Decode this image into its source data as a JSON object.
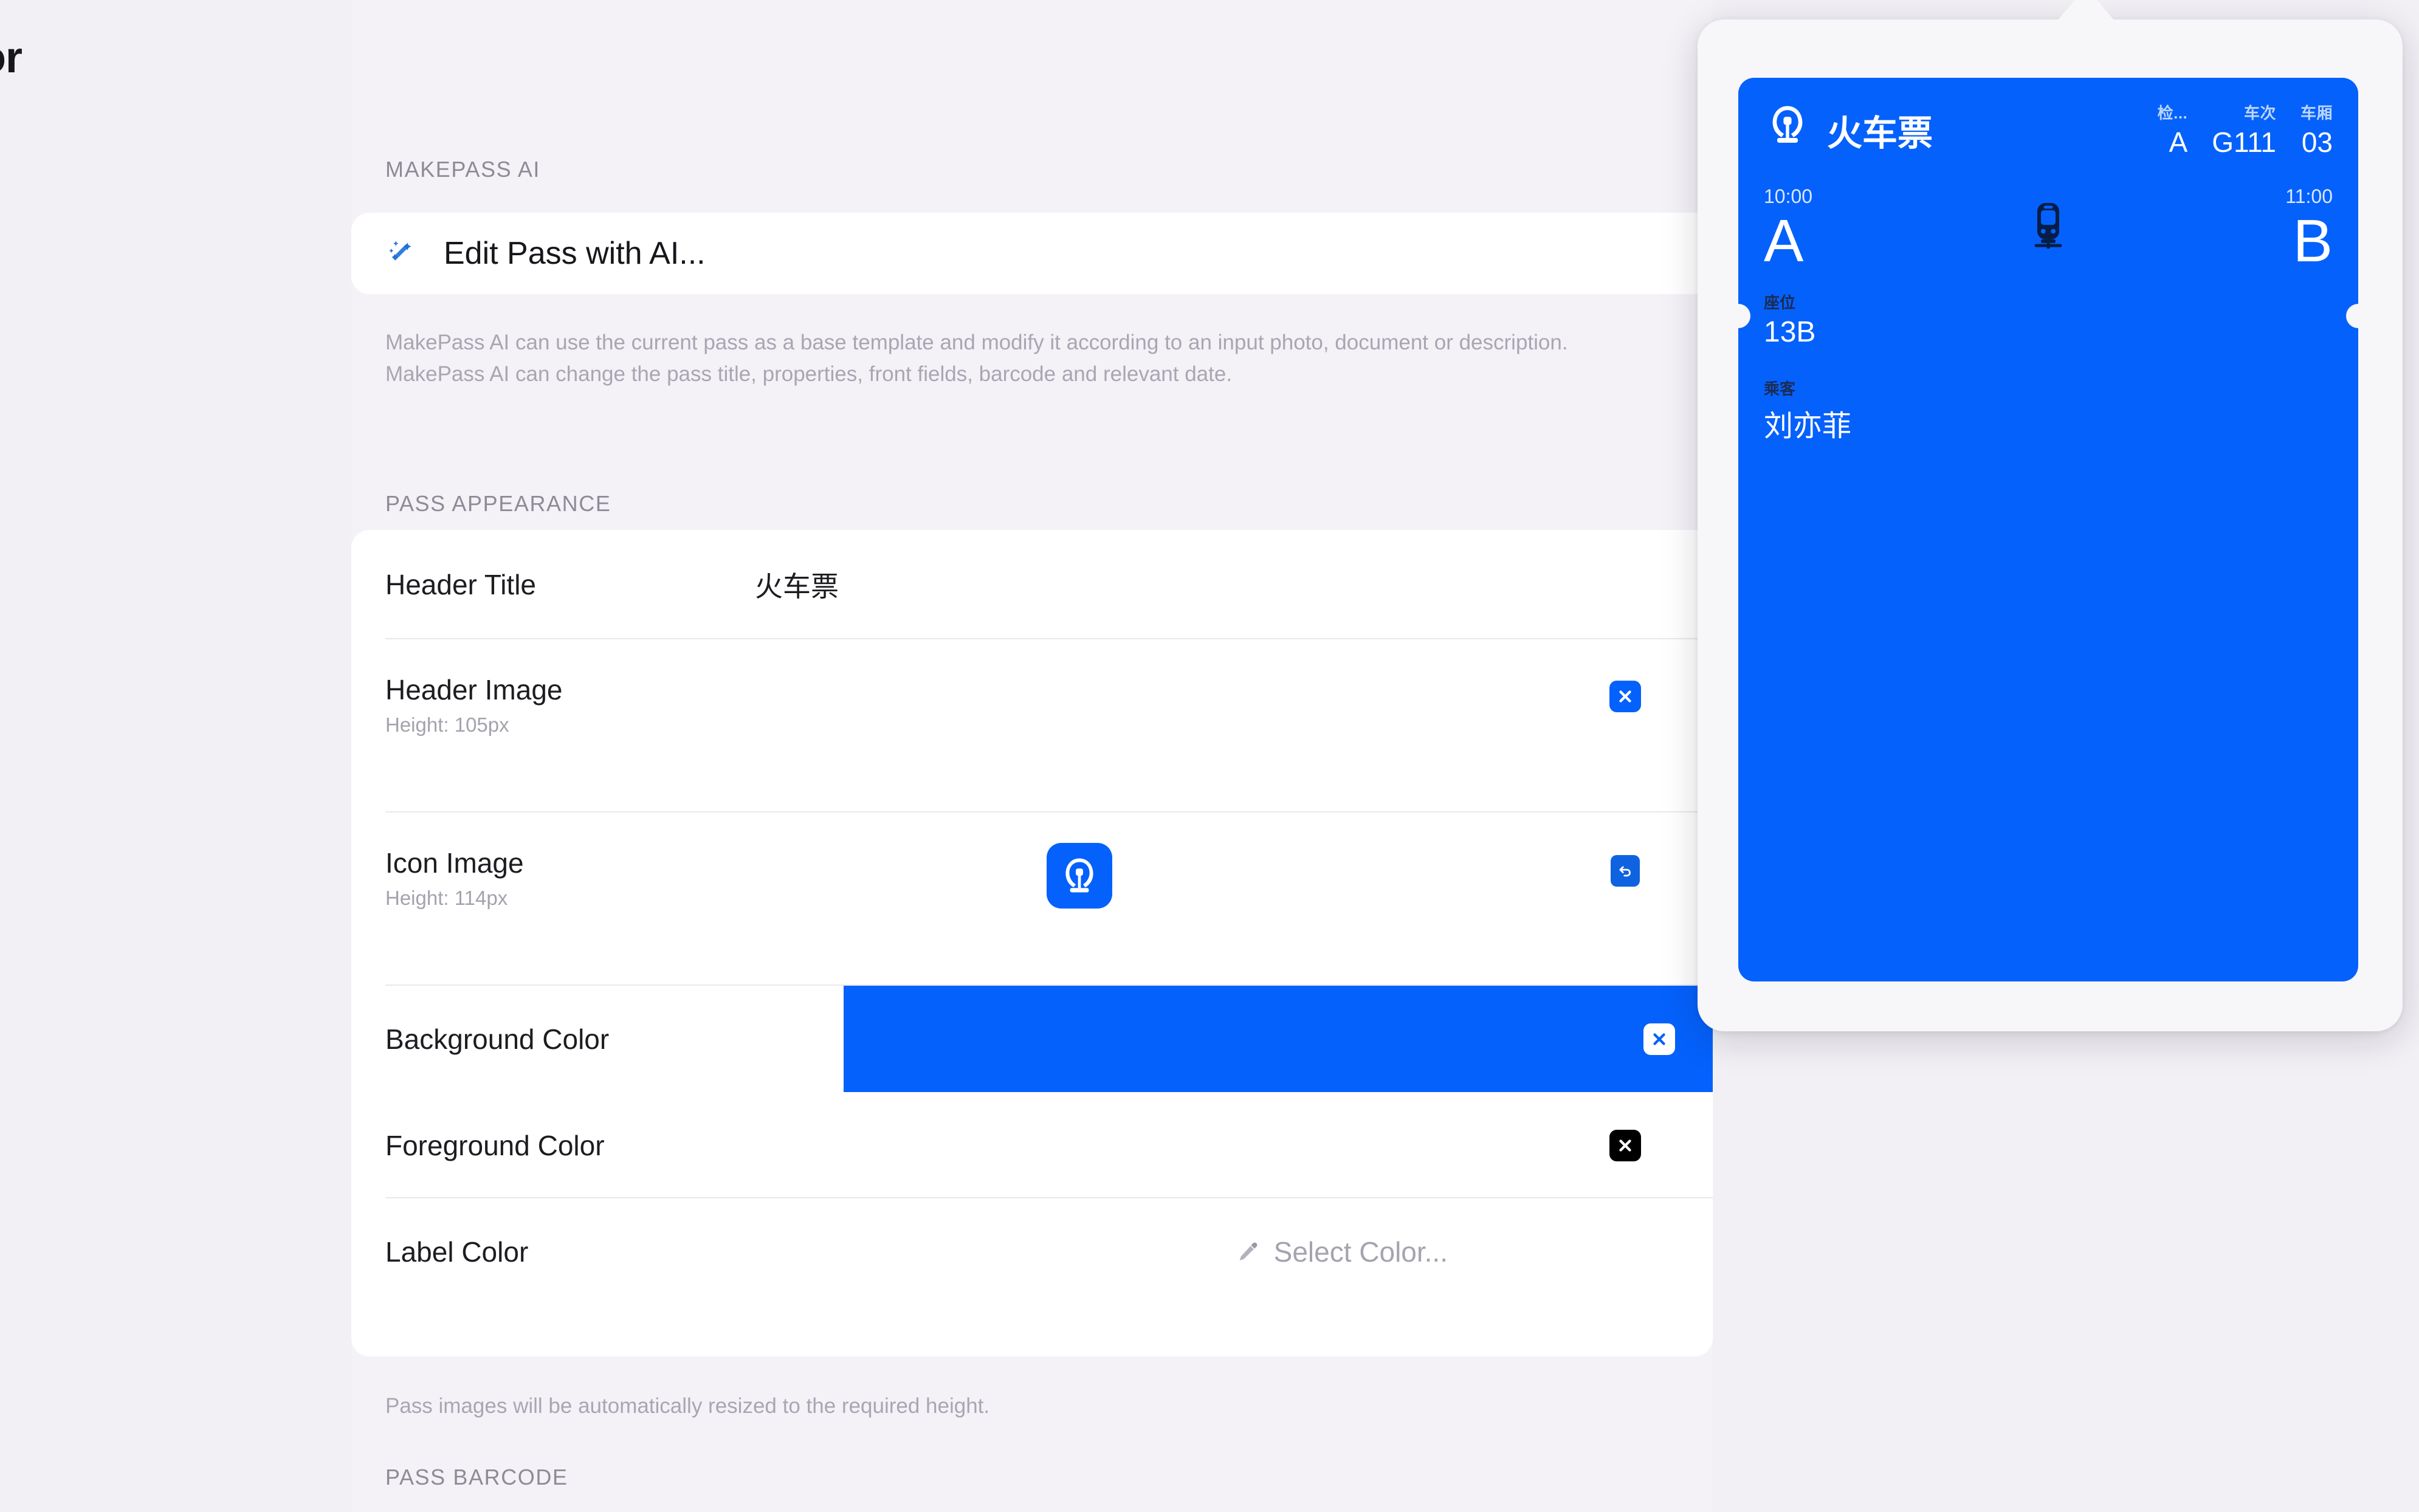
{
  "window": {
    "title_fragment": "or"
  },
  "sections": {
    "makepass_ai": {
      "header": "MAKEPASS AI",
      "edit_with_ai_label": "Edit Pass with AI...",
      "description": "MakePass AI can use the current pass as a base template and modify it according to an input photo, document or description. MakePass AI can change the pass title, properties, front fields, barcode and relevant date."
    },
    "pass_appearance": {
      "header": "PASS APPEARANCE",
      "rows": {
        "header_title": {
          "label": "Header Title",
          "value": "火车票"
        },
        "header_image": {
          "label": "Header Image",
          "sublabel": "Height: 105px",
          "clear_label": "×"
        },
        "icon_image": {
          "label": "Icon Image",
          "sublabel": "Height: 114px",
          "revert_label": "↺"
        },
        "background_color": {
          "label": "Background Color",
          "color": "#0561FC",
          "clear_label": "×"
        },
        "foreground_color": {
          "label": "Foreground Color",
          "color": "#000000",
          "clear_label": "×"
        },
        "label_color": {
          "label": "Label Color",
          "placeholder": "Select Color..."
        }
      },
      "footer_note": "Pass images will be automatically resized to the required height."
    },
    "pass_barcode": {
      "header": "PASS BARCODE"
    }
  },
  "preview": {
    "pass": {
      "background_color": "#0561FC",
      "title": "火车票",
      "header_fields": [
        {
          "label": "检...",
          "value": "A"
        },
        {
          "label": "车次",
          "value": "G111"
        },
        {
          "label": "车厢",
          "value": "03"
        }
      ],
      "primary": {
        "origin_time": "10:00",
        "origin_station": "A",
        "destination_time": "11:00",
        "destination_station": "B"
      },
      "secondary_fields": [
        {
          "label": "座位",
          "value": "13B"
        },
        {
          "label": "乘客",
          "value": "刘亦菲"
        }
      ]
    }
  }
}
